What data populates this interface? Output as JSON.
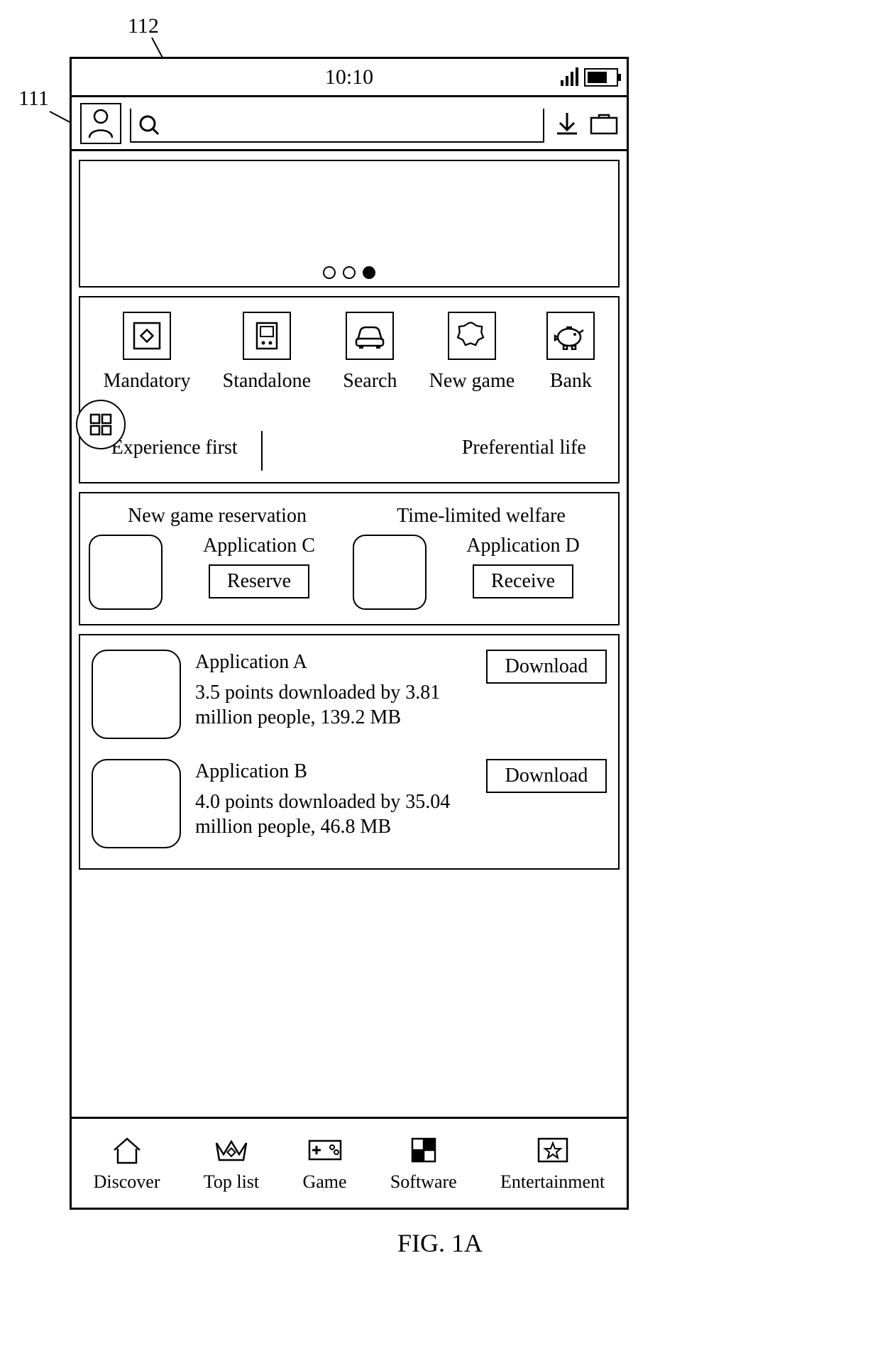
{
  "annotations": {
    "callout_111": "111",
    "callout_112": "112",
    "figure_label": "FIG. 1A"
  },
  "status": {
    "time": "10:10"
  },
  "carousel": {
    "page_count": 3,
    "active_index": 2
  },
  "categories": [
    {
      "label": "Mandatory",
      "icon": "diamond-frame-icon"
    },
    {
      "label": "Standalone",
      "icon": "gameboy-icon"
    },
    {
      "label": "Search",
      "icon": "car-icon"
    },
    {
      "label": "New game",
      "icon": "badge-icon"
    },
    {
      "label": "Bank",
      "icon": "piggy-icon"
    }
  ],
  "split_tabs": {
    "left": "Experience first",
    "right": "Preferential life"
  },
  "reservation": {
    "left": {
      "title": "New game reservation",
      "app_name": "Application C",
      "button": "Reserve"
    },
    "right": {
      "title": "Time-limited welfare",
      "app_name": "Application D",
      "button": "Receive"
    }
  },
  "app_list": [
    {
      "name": "Application A",
      "detail": "3.5 points downloaded by 3.81 million people, 139.2 MB",
      "button": "Download"
    },
    {
      "name": "Application B",
      "detail": "4.0 points downloaded by 35.04 million people, 46.8 MB",
      "button": "Download"
    }
  ],
  "bottom_nav": [
    {
      "label": "Discover",
      "icon": "home-icon"
    },
    {
      "label": "Top list",
      "icon": "crown-icon"
    },
    {
      "label": "Game",
      "icon": "gamepad-icon"
    },
    {
      "label": "Software",
      "icon": "grid-icon"
    },
    {
      "label": "Entertainment",
      "icon": "star-box-icon"
    }
  ]
}
